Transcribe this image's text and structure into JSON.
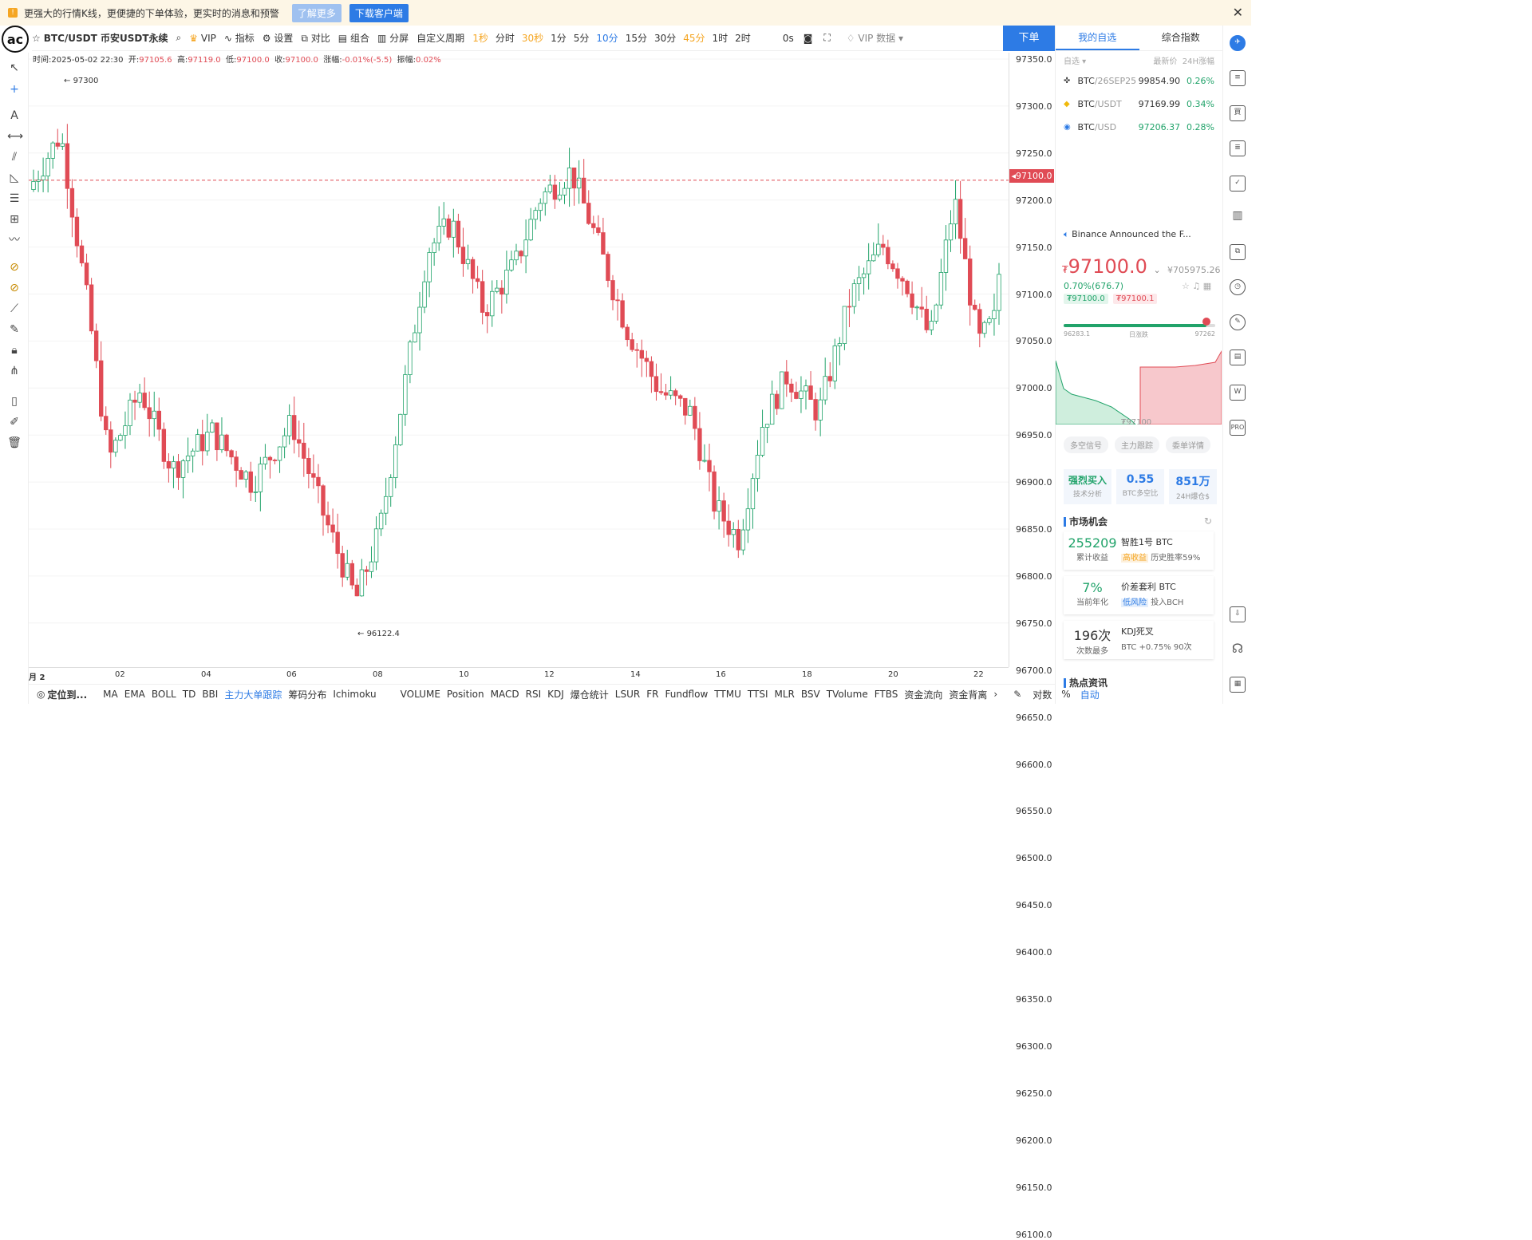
{
  "banner": {
    "text": "更强大的行情K线，更便捷的下单体验，更实时的消息和预警",
    "btn_more": "了解更多",
    "btn_download": "下载客户端",
    "close": "✕"
  },
  "logo": "ac",
  "toolbar": {
    "symbol": "BTC/USDT 币安USDT永续",
    "vip": "VIP",
    "indicators": "指标",
    "settings": "设置",
    "compare": "对比",
    "combine": "组合",
    "split": "分屏",
    "custom_period": "自定义周期",
    "periods": [
      "1秒",
      "分时",
      "30秒",
      "1分",
      "5分",
      "10分",
      "15分",
      "30分",
      "45分",
      "1时",
      "2时"
    ],
    "countdown": "0s",
    "vip_data": "VIP 数据",
    "order": "下单"
  },
  "ohlc": {
    "time": "时间:2025-05-02 22:30",
    "open_label": "开:",
    "open": "97105.6",
    "high_label": "高:",
    "high": "97119.0",
    "low_label": "低:",
    "low": "97100.0",
    "close_label": "收:",
    "close": "97100.0",
    "change_label": "涨幅:",
    "change": "-0.01%(-5.5)",
    "amp_label": "振幅:",
    "amp": "0.02%"
  },
  "annotations": {
    "high_mark": "97300",
    "low_mark": "96122.4"
  },
  "price_axis": [
    "97350.0",
    "97300.0",
    "97250.0",
    "97200.0",
    "97150.0",
    "97100.0",
    "97050.0",
    "97000.0",
    "96950.0",
    "96900.0",
    "96850.0",
    "96800.0",
    "96750.0",
    "96700.0",
    "96650.0",
    "96600.0",
    "96550.0",
    "96500.0",
    "96450.0",
    "96400.0",
    "96350.0",
    "96300.0",
    "96250.0",
    "96200.0",
    "96150.0",
    "96100.0"
  ],
  "current_price_tag": "97100.0",
  "x_axis": [
    "月 2",
    "02",
    "04",
    "06",
    "08",
    "10",
    "12",
    "14",
    "16",
    "18",
    "20",
    "22"
  ],
  "indicator_bar": {
    "locate": "定位到...",
    "main": [
      "MA",
      "EMA",
      "BOLL",
      "TD",
      "BBI",
      "主力大单跟踪",
      "筹码分布",
      "Ichimoku"
    ],
    "sub": [
      "VOLUME",
      "Position",
      "MACD",
      "RSI",
      "KDJ",
      "爆仓统计",
      "LSUR",
      "FR",
      "Fundflow",
      "TTMU",
      "TTSI",
      "MLR",
      "BSV",
      "TVolume",
      "FTBS",
      "资金流向",
      "资金背离"
    ],
    "log": "对数",
    "pct": "%",
    "auto": "自动"
  },
  "right": {
    "tabs": [
      "我的自选",
      "综合指数"
    ],
    "wl_head": {
      "group": "自选 ▾",
      "price": "最新价",
      "change": "24H涨幅"
    },
    "watchlist": [
      {
        "sym": "BTC",
        "quote": "/26SEP25",
        "price": "99854.90",
        "change": "0.26%"
      },
      {
        "sym": "BTC",
        "quote": "/USDT",
        "price": "97169.99",
        "change": "0.34%"
      },
      {
        "sym": "BTC",
        "quote": "/USD",
        "price": "97206.37",
        "change": "0.28%"
      }
    ],
    "news": "Binance Announced the F...",
    "big_price": "97100.0",
    "currency": "₮",
    "cny": "¥705975.26",
    "change": "0.70%(676.7)",
    "bid": "₮97100.0",
    "ask": "₮97100.1",
    "range_low": "96283.1",
    "range_label": "日涨跌",
    "range_high": "97262",
    "range_pos": 0.94,
    "depth_price": "₮97100",
    "signals": [
      "多空信号",
      "主力跟踪",
      "委单详情"
    ],
    "stats": [
      {
        "v": "强烈买入",
        "l": "技术分析"
      },
      {
        "v": "0.55",
        "l": "BTC多空比"
      },
      {
        "v": "851万",
        "l": "24H爆仓$"
      }
    ],
    "market_title": "市场机会",
    "cards": [
      {
        "n": "255209",
        "s": "累计收益",
        "t": "智胜1号 BTC",
        "tag": "高收益",
        "d": "历史胜率59%"
      },
      {
        "n": "7%",
        "s": "当前年化",
        "t": "价差套利 BTC",
        "tag": "低风险",
        "d": "投入BCH"
      },
      {
        "n": "196次",
        "s": "次数最多",
        "t": "KDJ死叉",
        "d": "BTC +0.75% 90次"
      }
    ],
    "hot_title": "热点资讯"
  },
  "colors": {
    "up": "#21a36a",
    "down": "#e04b55",
    "accent": "#2d7be5"
  }
}
